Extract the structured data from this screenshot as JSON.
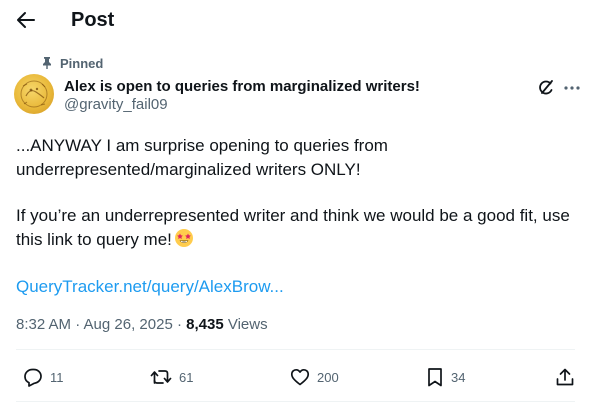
{
  "header": {
    "title": "Post"
  },
  "post": {
    "pinned_label": "Pinned",
    "author_name": "Alex is open to queries from marginalized writers!",
    "author_handle": "@gravity_fail09",
    "paragraph1": "...ANYWAY I am surprise opening to queries from underrepresented/marginalized writers ONLY!",
    "paragraph2": "If you’re an underrepresented writer and think we would be a good fit, use this link to query me!",
    "link_text": "QueryTracker.net/query/AlexBrow...",
    "timestamp": "8:32 AM · Aug 26, 2025 · ",
    "views_count": "8,435",
    "views_label": " Views"
  },
  "actions": {
    "replies": "11",
    "reposts": "61",
    "likes": "200",
    "bookmarks": "34"
  },
  "icons": [
    "back-arrow-icon",
    "pin-icon",
    "grok-icon",
    "more-icon",
    "star-struck-emoji-icon",
    "reply-icon",
    "repost-icon",
    "like-icon",
    "bookmark-icon",
    "share-icon"
  ],
  "colors": {
    "link": "#1d9bf0",
    "muted": "#536471",
    "text": "#0f1419",
    "divider": "#eff3f4"
  }
}
